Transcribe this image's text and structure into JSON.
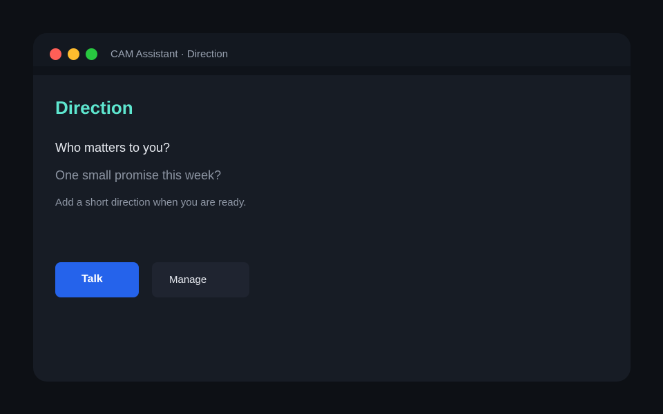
{
  "window": {
    "title": "CAM Assistant · Direction",
    "controls": {
      "close_color": "#ff5f57",
      "minimize_color": "#febc2e",
      "maximize_color": "#28c840"
    }
  },
  "main": {
    "heading": "Direction",
    "prompts": [
      "Who matters to you?",
      "One small promise this week?"
    ],
    "hint": "Add a short direction when you are ready."
  },
  "actions": {
    "primary_label": "Talk",
    "secondary_label": "Manage"
  },
  "colors": {
    "accent": "#5ee6cf",
    "primary_button": "#2563eb"
  }
}
